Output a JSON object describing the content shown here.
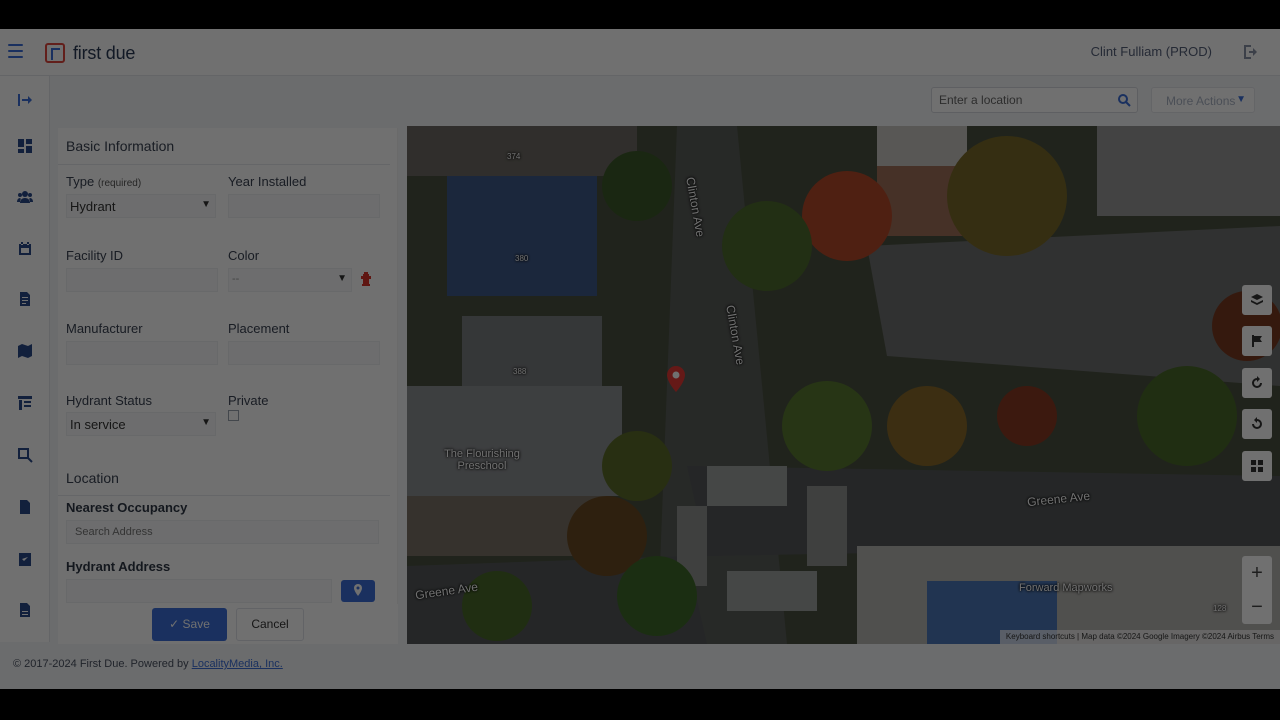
{
  "header": {
    "logo_text": "first due",
    "user_name": "Clint Fulliam (PROD)"
  },
  "toolbar": {
    "location_placeholder": "Enter a location",
    "more_actions_label": "More Actions"
  },
  "form": {
    "basic_info_title": "Basic Information",
    "type_label": "Type",
    "type_required": "(required)",
    "type_value": "Hydrant",
    "year_installed_label": "Year Installed",
    "facility_id_label": "Facility ID",
    "color_label": "Color",
    "color_value": "--",
    "manufacturer_label": "Manufacturer",
    "placement_label": "Placement",
    "hydrant_status_label": "Hydrant Status",
    "hydrant_status_value": "In service",
    "private_label": "Private",
    "location_title": "Location",
    "nearest_occupancy_label": "Nearest Occupancy",
    "search_address_placeholder": "Search Address",
    "hydrant_address_label": "Hydrant Address"
  },
  "actions": {
    "save_label": "Save",
    "cancel_label": "Cancel"
  },
  "map": {
    "labels": {
      "clinton_ave_1": "Clinton Ave",
      "clinton_ave_2": "Clinton Ave",
      "greene_ave_1": "Greene Ave",
      "greene_ave_2": "Greene Ave",
      "preschool": "The Flourishing Preschool",
      "forward_mapworks": "Forward Mapworks",
      "num_374": "374",
      "num_380": "380",
      "num_388": "388",
      "num_128": "128"
    },
    "attribution": "Keyboard shortcuts | Map data ©2024 Google Imagery ©2024 Airbus   Terms"
  },
  "footer": {
    "copyright_text": "© 2017-2024 First Due. Powered by ",
    "company_link": "LocalityMedia, Inc."
  },
  "colors": {
    "accent": "#3b6fd8",
    "logo_red": "#e0483e"
  }
}
